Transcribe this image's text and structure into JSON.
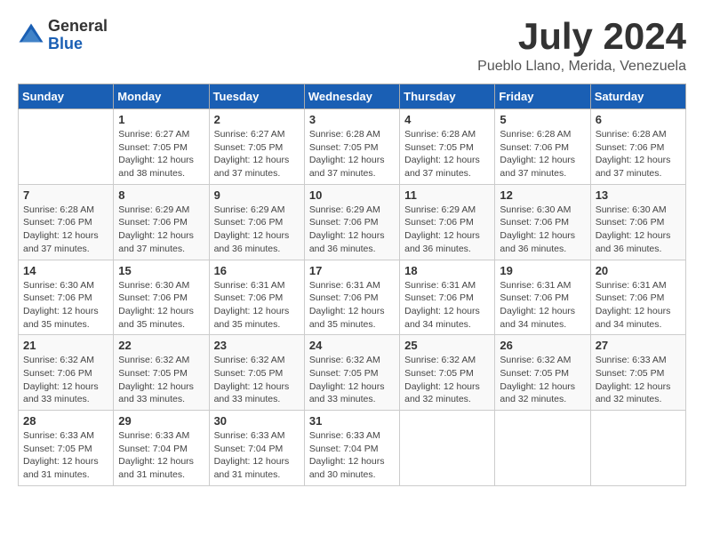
{
  "logo": {
    "general": "General",
    "blue": "Blue"
  },
  "title": "July 2024",
  "location": "Pueblo Llano, Merida, Venezuela",
  "days_of_week": [
    "Sunday",
    "Monday",
    "Tuesday",
    "Wednesday",
    "Thursday",
    "Friday",
    "Saturday"
  ],
  "weeks": [
    [
      {
        "day": null,
        "info": null
      },
      {
        "day": "1",
        "info": "Sunrise: 6:27 AM\nSunset: 7:05 PM\nDaylight: 12 hours\nand 38 minutes."
      },
      {
        "day": "2",
        "info": "Sunrise: 6:27 AM\nSunset: 7:05 PM\nDaylight: 12 hours\nand 37 minutes."
      },
      {
        "day": "3",
        "info": "Sunrise: 6:28 AM\nSunset: 7:05 PM\nDaylight: 12 hours\nand 37 minutes."
      },
      {
        "day": "4",
        "info": "Sunrise: 6:28 AM\nSunset: 7:05 PM\nDaylight: 12 hours\nand 37 minutes."
      },
      {
        "day": "5",
        "info": "Sunrise: 6:28 AM\nSunset: 7:06 PM\nDaylight: 12 hours\nand 37 minutes."
      },
      {
        "day": "6",
        "info": "Sunrise: 6:28 AM\nSunset: 7:06 PM\nDaylight: 12 hours\nand 37 minutes."
      }
    ],
    [
      {
        "day": "7",
        "info": "Sunrise: 6:28 AM\nSunset: 7:06 PM\nDaylight: 12 hours\nand 37 minutes."
      },
      {
        "day": "8",
        "info": "Sunrise: 6:29 AM\nSunset: 7:06 PM\nDaylight: 12 hours\nand 37 minutes."
      },
      {
        "day": "9",
        "info": "Sunrise: 6:29 AM\nSunset: 7:06 PM\nDaylight: 12 hours\nand 36 minutes."
      },
      {
        "day": "10",
        "info": "Sunrise: 6:29 AM\nSunset: 7:06 PM\nDaylight: 12 hours\nand 36 minutes."
      },
      {
        "day": "11",
        "info": "Sunrise: 6:29 AM\nSunset: 7:06 PM\nDaylight: 12 hours\nand 36 minutes."
      },
      {
        "day": "12",
        "info": "Sunrise: 6:30 AM\nSunset: 7:06 PM\nDaylight: 12 hours\nand 36 minutes."
      },
      {
        "day": "13",
        "info": "Sunrise: 6:30 AM\nSunset: 7:06 PM\nDaylight: 12 hours\nand 36 minutes."
      }
    ],
    [
      {
        "day": "14",
        "info": "Sunrise: 6:30 AM\nSunset: 7:06 PM\nDaylight: 12 hours\nand 35 minutes."
      },
      {
        "day": "15",
        "info": "Sunrise: 6:30 AM\nSunset: 7:06 PM\nDaylight: 12 hours\nand 35 minutes."
      },
      {
        "day": "16",
        "info": "Sunrise: 6:31 AM\nSunset: 7:06 PM\nDaylight: 12 hours\nand 35 minutes."
      },
      {
        "day": "17",
        "info": "Sunrise: 6:31 AM\nSunset: 7:06 PM\nDaylight: 12 hours\nand 35 minutes."
      },
      {
        "day": "18",
        "info": "Sunrise: 6:31 AM\nSunset: 7:06 PM\nDaylight: 12 hours\nand 34 minutes."
      },
      {
        "day": "19",
        "info": "Sunrise: 6:31 AM\nSunset: 7:06 PM\nDaylight: 12 hours\nand 34 minutes."
      },
      {
        "day": "20",
        "info": "Sunrise: 6:31 AM\nSunset: 7:06 PM\nDaylight: 12 hours\nand 34 minutes."
      }
    ],
    [
      {
        "day": "21",
        "info": "Sunrise: 6:32 AM\nSunset: 7:06 PM\nDaylight: 12 hours\nand 33 minutes."
      },
      {
        "day": "22",
        "info": "Sunrise: 6:32 AM\nSunset: 7:05 PM\nDaylight: 12 hours\nand 33 minutes."
      },
      {
        "day": "23",
        "info": "Sunrise: 6:32 AM\nSunset: 7:05 PM\nDaylight: 12 hours\nand 33 minutes."
      },
      {
        "day": "24",
        "info": "Sunrise: 6:32 AM\nSunset: 7:05 PM\nDaylight: 12 hours\nand 33 minutes."
      },
      {
        "day": "25",
        "info": "Sunrise: 6:32 AM\nSunset: 7:05 PM\nDaylight: 12 hours\nand 32 minutes."
      },
      {
        "day": "26",
        "info": "Sunrise: 6:32 AM\nSunset: 7:05 PM\nDaylight: 12 hours\nand 32 minutes."
      },
      {
        "day": "27",
        "info": "Sunrise: 6:33 AM\nSunset: 7:05 PM\nDaylight: 12 hours\nand 32 minutes."
      }
    ],
    [
      {
        "day": "28",
        "info": "Sunrise: 6:33 AM\nSunset: 7:05 PM\nDaylight: 12 hours\nand 31 minutes."
      },
      {
        "day": "29",
        "info": "Sunrise: 6:33 AM\nSunset: 7:04 PM\nDaylight: 12 hours\nand 31 minutes."
      },
      {
        "day": "30",
        "info": "Sunrise: 6:33 AM\nSunset: 7:04 PM\nDaylight: 12 hours\nand 31 minutes."
      },
      {
        "day": "31",
        "info": "Sunrise: 6:33 AM\nSunset: 7:04 PM\nDaylight: 12 hours\nand 30 minutes."
      },
      {
        "day": null,
        "info": null
      },
      {
        "day": null,
        "info": null
      },
      {
        "day": null,
        "info": null
      }
    ]
  ]
}
